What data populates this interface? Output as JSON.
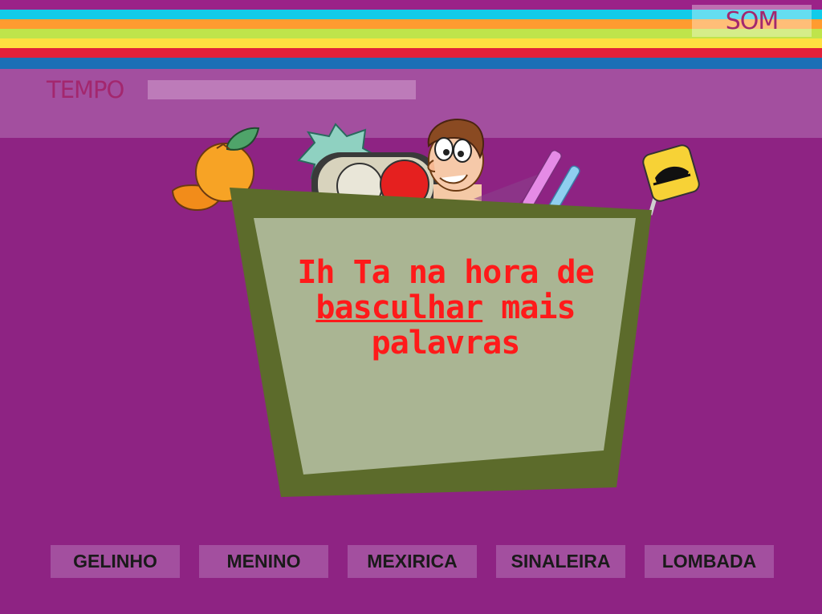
{
  "header": {
    "sound_label": "SOM",
    "timer_label": "TEMPO",
    "timer_remaining": 1.0
  },
  "colors": {
    "background": "#8e2383",
    "band": "#a34f9f",
    "stripes": [
      "#13cbe9",
      "#ff9b30",
      "#bfe44b",
      "#ffe040",
      "#e2213a",
      "#1b6fb6"
    ],
    "message": "#ff1a1a",
    "board_frame": "#5c6b2b",
    "board_face": "#aab593"
  },
  "board": {
    "line1": "Ih Ta na hora de",
    "line2_underlined": "basculhar",
    "line2_rest": " mais",
    "line3": "palavras"
  },
  "items": [
    "mexirica-icon",
    "traffic-light-icon",
    "boy-icon",
    "gel-pens-icon",
    "speed-bump-sign-icon"
  ],
  "options": [
    "GELINHO",
    "MENINO",
    "MEXIRICA",
    "SINALEIRA",
    "LOMBADA"
  ]
}
